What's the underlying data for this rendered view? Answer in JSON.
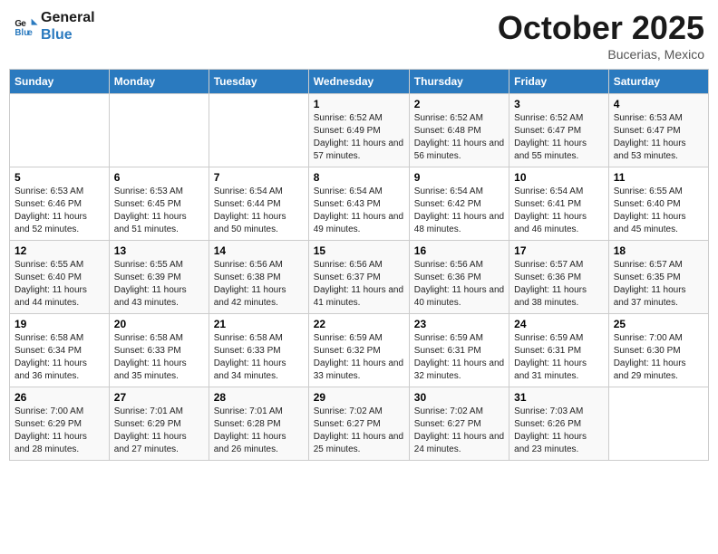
{
  "header": {
    "logo_line1": "General",
    "logo_line2": "Blue",
    "month": "October 2025",
    "location": "Bucerias, Mexico"
  },
  "weekdays": [
    "Sunday",
    "Monday",
    "Tuesday",
    "Wednesday",
    "Thursday",
    "Friday",
    "Saturday"
  ],
  "weeks": [
    [
      {
        "day": "",
        "info": ""
      },
      {
        "day": "",
        "info": ""
      },
      {
        "day": "",
        "info": ""
      },
      {
        "day": "1",
        "info": "Sunrise: 6:52 AM\nSunset: 6:49 PM\nDaylight: 11 hours and 57 minutes."
      },
      {
        "day": "2",
        "info": "Sunrise: 6:52 AM\nSunset: 6:48 PM\nDaylight: 11 hours and 56 minutes."
      },
      {
        "day": "3",
        "info": "Sunrise: 6:52 AM\nSunset: 6:47 PM\nDaylight: 11 hours and 55 minutes."
      },
      {
        "day": "4",
        "info": "Sunrise: 6:53 AM\nSunset: 6:47 PM\nDaylight: 11 hours and 53 minutes."
      }
    ],
    [
      {
        "day": "5",
        "info": "Sunrise: 6:53 AM\nSunset: 6:46 PM\nDaylight: 11 hours and 52 minutes."
      },
      {
        "day": "6",
        "info": "Sunrise: 6:53 AM\nSunset: 6:45 PM\nDaylight: 11 hours and 51 minutes."
      },
      {
        "day": "7",
        "info": "Sunrise: 6:54 AM\nSunset: 6:44 PM\nDaylight: 11 hours and 50 minutes."
      },
      {
        "day": "8",
        "info": "Sunrise: 6:54 AM\nSunset: 6:43 PM\nDaylight: 11 hours and 49 minutes."
      },
      {
        "day": "9",
        "info": "Sunrise: 6:54 AM\nSunset: 6:42 PM\nDaylight: 11 hours and 48 minutes."
      },
      {
        "day": "10",
        "info": "Sunrise: 6:54 AM\nSunset: 6:41 PM\nDaylight: 11 hours and 46 minutes."
      },
      {
        "day": "11",
        "info": "Sunrise: 6:55 AM\nSunset: 6:40 PM\nDaylight: 11 hours and 45 minutes."
      }
    ],
    [
      {
        "day": "12",
        "info": "Sunrise: 6:55 AM\nSunset: 6:40 PM\nDaylight: 11 hours and 44 minutes."
      },
      {
        "day": "13",
        "info": "Sunrise: 6:55 AM\nSunset: 6:39 PM\nDaylight: 11 hours and 43 minutes."
      },
      {
        "day": "14",
        "info": "Sunrise: 6:56 AM\nSunset: 6:38 PM\nDaylight: 11 hours and 42 minutes."
      },
      {
        "day": "15",
        "info": "Sunrise: 6:56 AM\nSunset: 6:37 PM\nDaylight: 11 hours and 41 minutes."
      },
      {
        "day": "16",
        "info": "Sunrise: 6:56 AM\nSunset: 6:36 PM\nDaylight: 11 hours and 40 minutes."
      },
      {
        "day": "17",
        "info": "Sunrise: 6:57 AM\nSunset: 6:36 PM\nDaylight: 11 hours and 38 minutes."
      },
      {
        "day": "18",
        "info": "Sunrise: 6:57 AM\nSunset: 6:35 PM\nDaylight: 11 hours and 37 minutes."
      }
    ],
    [
      {
        "day": "19",
        "info": "Sunrise: 6:58 AM\nSunset: 6:34 PM\nDaylight: 11 hours and 36 minutes."
      },
      {
        "day": "20",
        "info": "Sunrise: 6:58 AM\nSunset: 6:33 PM\nDaylight: 11 hours and 35 minutes."
      },
      {
        "day": "21",
        "info": "Sunrise: 6:58 AM\nSunset: 6:33 PM\nDaylight: 11 hours and 34 minutes."
      },
      {
        "day": "22",
        "info": "Sunrise: 6:59 AM\nSunset: 6:32 PM\nDaylight: 11 hours and 33 minutes."
      },
      {
        "day": "23",
        "info": "Sunrise: 6:59 AM\nSunset: 6:31 PM\nDaylight: 11 hours and 32 minutes."
      },
      {
        "day": "24",
        "info": "Sunrise: 6:59 AM\nSunset: 6:31 PM\nDaylight: 11 hours and 31 minutes."
      },
      {
        "day": "25",
        "info": "Sunrise: 7:00 AM\nSunset: 6:30 PM\nDaylight: 11 hours and 29 minutes."
      }
    ],
    [
      {
        "day": "26",
        "info": "Sunrise: 7:00 AM\nSunset: 6:29 PM\nDaylight: 11 hours and 28 minutes."
      },
      {
        "day": "27",
        "info": "Sunrise: 7:01 AM\nSunset: 6:29 PM\nDaylight: 11 hours and 27 minutes."
      },
      {
        "day": "28",
        "info": "Sunrise: 7:01 AM\nSunset: 6:28 PM\nDaylight: 11 hours and 26 minutes."
      },
      {
        "day": "29",
        "info": "Sunrise: 7:02 AM\nSunset: 6:27 PM\nDaylight: 11 hours and 25 minutes."
      },
      {
        "day": "30",
        "info": "Sunrise: 7:02 AM\nSunset: 6:27 PM\nDaylight: 11 hours and 24 minutes."
      },
      {
        "day": "31",
        "info": "Sunrise: 7:03 AM\nSunset: 6:26 PM\nDaylight: 11 hours and 23 minutes."
      },
      {
        "day": "",
        "info": ""
      }
    ]
  ]
}
